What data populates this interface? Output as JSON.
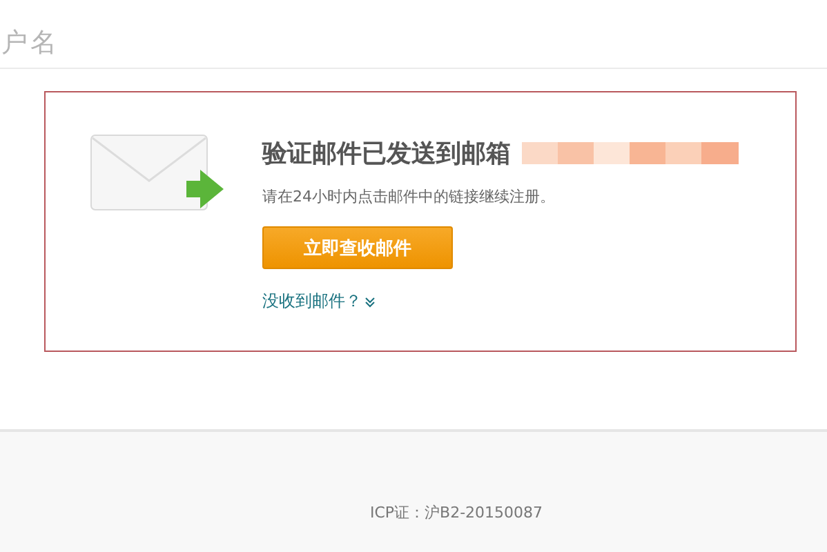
{
  "header": {
    "title": "户名"
  },
  "notice": {
    "title": "验证邮件已发送到邮箱",
    "message": "请在24小时内点击邮件中的链接继续注册。",
    "button": "立即查收邮件",
    "help_link": "没收到邮件？",
    "help_expanded": false
  },
  "footer": {
    "license": "ICP证：沪B2-20150087"
  }
}
